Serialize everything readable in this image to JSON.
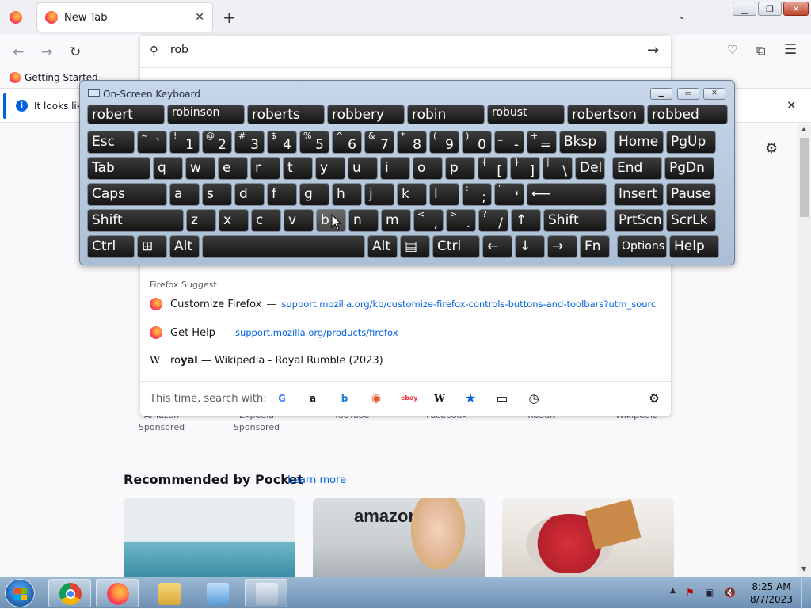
{
  "browser": {
    "tab_title": "New Tab",
    "bookmark_getting_started": "Getting Started",
    "notification_text": "It looks like",
    "url_input": "rob"
  },
  "suggestions": {
    "heading": "Firefox Suggest",
    "items": [
      {
        "title": "Customize Firefox",
        "sep": "—",
        "url": "support.mozilla.org/kb/customize-firefox-controls-buttons-and-toolbars?utm_source=firef"
      },
      {
        "title": "Get Help",
        "sep": "—",
        "url": "support.mozilla.org/products/firefox"
      }
    ],
    "wiki": {
      "prefix": "ro",
      "bold": "yal",
      "rest": " — Wikipedia - Royal Rumble (2023)"
    },
    "oneoff_label": "This time, search with:",
    "engines": [
      "google-icon",
      "amazon-icon",
      "bing-icon",
      "duckduckgo-icon",
      "ebay-icon",
      "wikipedia-icon",
      "bookmarks-icon",
      "tabs-icon",
      "history-icon",
      "search-settings-icon"
    ]
  },
  "osk": {
    "title": "On-Screen Keyboard",
    "predictions": [
      "robert",
      "robinson",
      "roberts",
      "robbery",
      "robin",
      "robust",
      "robertson",
      "robbed"
    ],
    "rows": [
      [
        {
          "l": "Esc"
        },
        {
          "s": "~",
          "m": "`"
        },
        {
          "s": "!",
          "m": "1"
        },
        {
          "s": "@",
          "m": "2"
        },
        {
          "s": "#",
          "m": "3"
        },
        {
          "s": "$",
          "m": "4"
        },
        {
          "s": "%",
          "m": "5"
        },
        {
          "s": "^",
          "m": "6"
        },
        {
          "s": "&",
          "m": "7"
        },
        {
          "s": "*",
          "m": "8"
        },
        {
          "s": "(",
          "m": "9"
        },
        {
          "s": ")",
          "m": "0"
        },
        {
          "s": "_",
          "m": "-"
        },
        {
          "s": "+",
          "m": "="
        },
        {
          "l": "Bksp"
        },
        {
          "l": "Home"
        },
        {
          "l": "PgUp"
        }
      ],
      [
        {
          "l": "Tab"
        },
        {
          "l": "q"
        },
        {
          "l": "w"
        },
        {
          "l": "e"
        },
        {
          "l": "r"
        },
        {
          "l": "t"
        },
        {
          "l": "y"
        },
        {
          "l": "u"
        },
        {
          "l": "i"
        },
        {
          "l": "o"
        },
        {
          "l": "p"
        },
        {
          "s": "{",
          "m": "["
        },
        {
          "s": "}",
          "m": "]"
        },
        {
          "s": "|",
          "m": "\\"
        },
        {
          "l": "Del"
        },
        {
          "l": "End"
        },
        {
          "l": "PgDn"
        }
      ],
      [
        {
          "l": "Caps"
        },
        {
          "l": "a"
        },
        {
          "l": "s"
        },
        {
          "l": "d"
        },
        {
          "l": "f"
        },
        {
          "l": "g"
        },
        {
          "l": "h"
        },
        {
          "l": "j"
        },
        {
          "l": "k"
        },
        {
          "l": "l"
        },
        {
          "s": ":",
          "m": ";"
        },
        {
          "s": "\"",
          "m": "'"
        },
        {
          "l": "⟵"
        },
        {
          "l": "Insert"
        },
        {
          "l": "Pause"
        }
      ],
      [
        {
          "l": "Shift"
        },
        {
          "l": "z"
        },
        {
          "l": "x"
        },
        {
          "l": "c"
        },
        {
          "l": "v"
        },
        {
          "l": "b"
        },
        {
          "l": "n"
        },
        {
          "l": "m"
        },
        {
          "s": "<",
          "m": ","
        },
        {
          "s": ">",
          "m": "."
        },
        {
          "s": "?",
          "m": "/"
        },
        {
          "l": "↑"
        },
        {
          "l": "Shift"
        },
        {
          "l": "PrtScn"
        },
        {
          "l": "ScrLk"
        }
      ],
      [
        {
          "l": "Ctrl"
        },
        {
          "l": "⊞"
        },
        {
          "l": "Alt"
        },
        {
          "l": ""
        },
        {
          "l": "Alt"
        },
        {
          "l": "▤"
        },
        {
          "l": "Ctrl"
        },
        {
          "l": "←"
        },
        {
          "l": "↓"
        },
        {
          "l": "→"
        },
        {
          "l": "Fn"
        },
        {
          "l": "Options"
        },
        {
          "l": "Help"
        }
      ]
    ]
  },
  "newtab": {
    "sites": [
      {
        "name": "Amazon",
        "sub": "Sponsored"
      },
      {
        "name": "Expedia",
        "sub": "Sponsored"
      },
      {
        "name": "YouTube",
        "sub": ""
      },
      {
        "name": "Facebook",
        "sub": ""
      },
      {
        "name": "Reddit",
        "sub": ""
      },
      {
        "name": "Wikipedia",
        "sub": ""
      }
    ],
    "pocket_heading": "Recommended by Pocket",
    "pocket_learn": "Learn more"
  },
  "taskbar": {
    "time": "8:25 AM",
    "date": "8/7/2023"
  },
  "colors": {
    "accent": "#0060df",
    "osk_key": "#1e1e1e",
    "taskbar": "#7f9fc0"
  }
}
